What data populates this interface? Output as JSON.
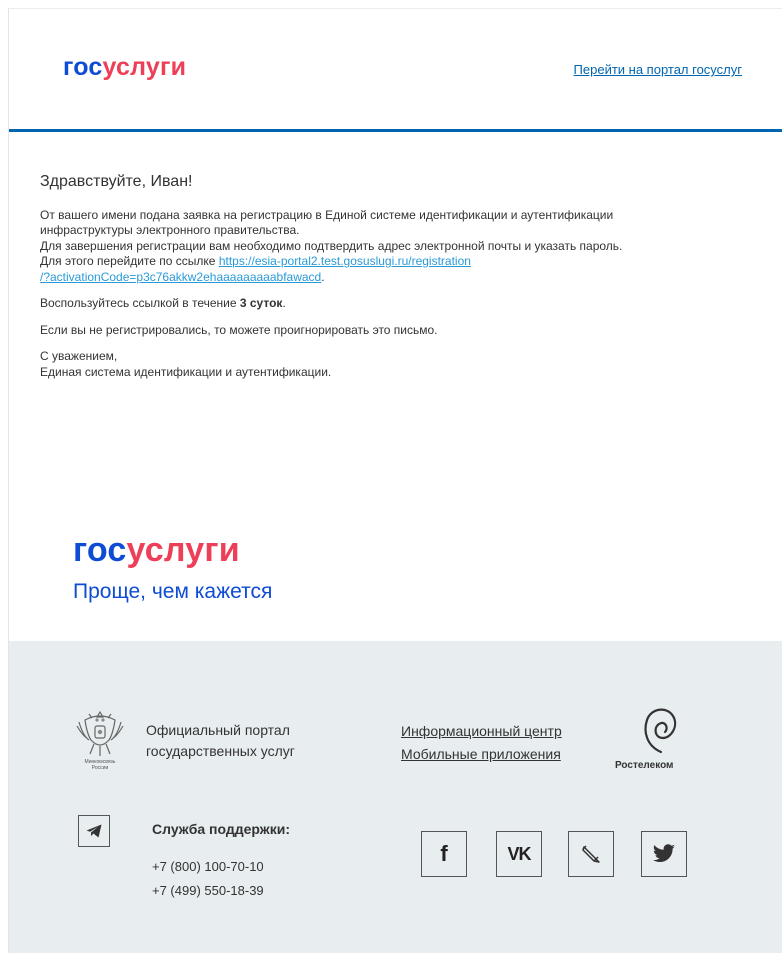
{
  "header": {
    "logo_part1": "гос",
    "logo_part2": "услуги",
    "portal_link": "Перейти на портал госуслуг"
  },
  "body": {
    "greeting": "Здравствуйте, Иван!",
    "para1_line1": "От вашего имени подана заявка на регистрацию в Единой системе идентификации и аутентификации",
    "para1_line2": "инфраструктуры электронного правительства.",
    "para1_line3": "Для завершения регистрации вам необходимо подтвердить адрес электронной почты и указать пароль.",
    "para1_line4_prefix": "Для этого перейдите по ссылке ",
    "activation_link_part1": "https://esia-portal2.test.gosuslugi.ru/registration",
    "activation_link_part2": "/?activationCode=p3c76akkw2ehaaaaaaaaabfawacd",
    "link_suffix": ".",
    "validity_prefix": "Воспользуйтесь ссылкой в течение ",
    "validity_bold": "3 суток",
    "validity_suffix": ".",
    "ignore_text": "Если вы не регистрировались, то можете проигнорировать это письмо.",
    "regards": "С уважением,",
    "signature": "Единая система идентификации и аутентификации."
  },
  "promo": {
    "logo_part1": "гос",
    "logo_part2": "услуги",
    "slogan": "Проще, чем кажется"
  },
  "footer": {
    "ministry_label_1": "Минкомсвязь",
    "ministry_label_2": "России",
    "official_line1": "Официальный портал",
    "official_line2": "государственных услуг",
    "info_center": "Информационный центр",
    "mobile_apps": "Мобильные приложения",
    "rostelecom": "Ростелеком",
    "support_title": "Служба поддержки:",
    "phone1": "+7 (800) 100-70-10",
    "phone2": "+7 (499) 550-18-39",
    "social": {
      "facebook_glyph": "f",
      "vk_glyph": "VK"
    }
  },
  "colors": {
    "brand_blue": "#0d4cd3",
    "brand_red": "#ee3f58",
    "header_line": "#0065b1",
    "link": "#2a9ad8",
    "footer_bg": "#e8edf0"
  }
}
